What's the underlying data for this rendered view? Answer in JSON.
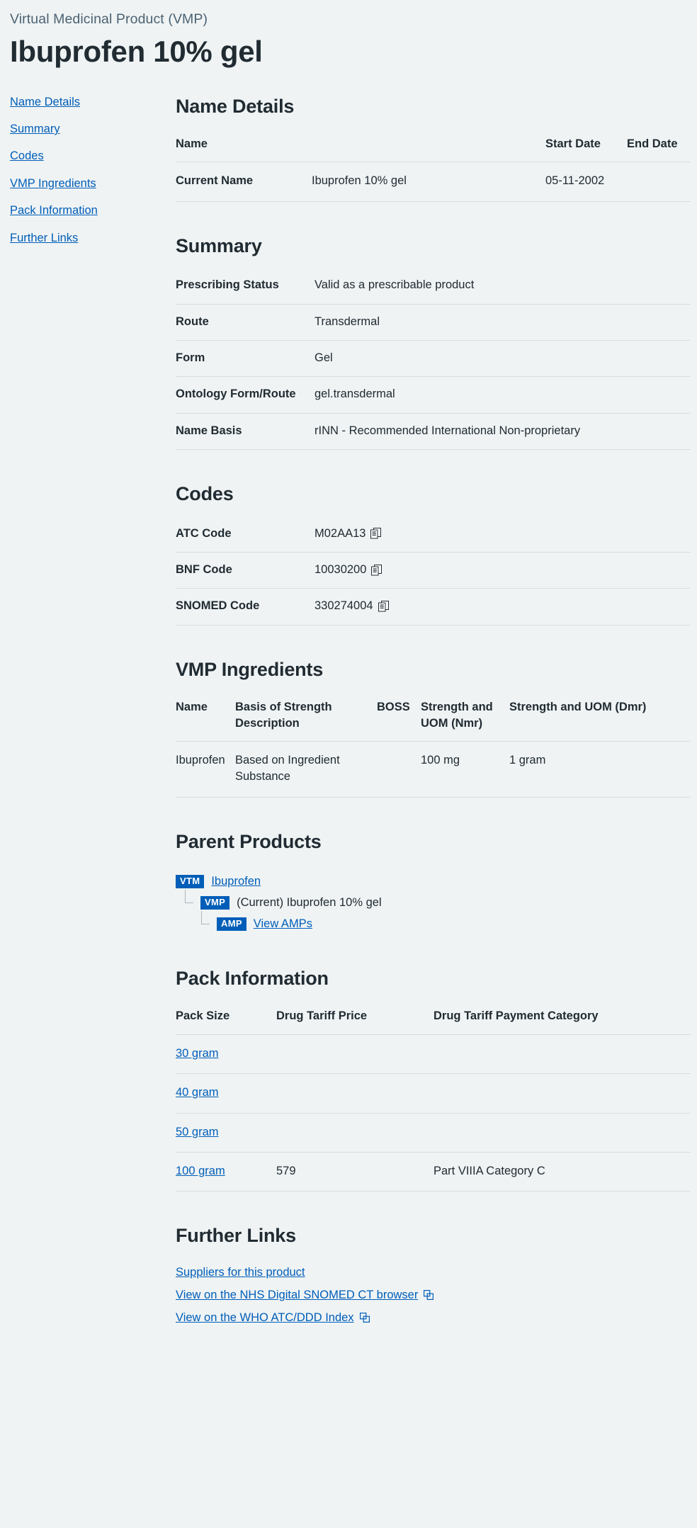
{
  "header": {
    "eyebrow": "Virtual Medicinal Product (VMP)",
    "title": "Ibuprofen 10% gel"
  },
  "sidebar": {
    "items": [
      {
        "label": "Name Details"
      },
      {
        "label": "Summary"
      },
      {
        "label": "Codes"
      },
      {
        "label": "VMP Ingredients"
      },
      {
        "label": "Pack Information"
      },
      {
        "label": "Further Links"
      }
    ]
  },
  "name_details": {
    "title": "Name Details",
    "columns": [
      "Name",
      "",
      "Start Date",
      "End Date"
    ],
    "rows": [
      {
        "label": "Current Name",
        "name": "Ibuprofen 10% gel",
        "start_date": "05-11-2002",
        "end_date": ""
      }
    ]
  },
  "summary": {
    "title": "Summary",
    "rows": [
      {
        "key": "Prescribing Status",
        "value": "Valid as a prescribable product"
      },
      {
        "key": "Route",
        "value": "Transdermal"
      },
      {
        "key": "Form",
        "value": "Gel"
      },
      {
        "key": "Ontology Form/Route",
        "value": "gel.transdermal"
      },
      {
        "key": "Name Basis",
        "value": "rINN - Recommended International Non-proprietary"
      }
    ]
  },
  "codes": {
    "title": "Codes",
    "rows": [
      {
        "key": "ATC Code",
        "value": "M02AA13",
        "copy_icon": "copy-icon"
      },
      {
        "key": "BNF Code",
        "value": "10030200",
        "copy_icon": "copy-icon"
      },
      {
        "key": "SNOMED Code",
        "value": "330274004",
        "copy_icon": "copy-icon"
      }
    ]
  },
  "vmp_ingredients": {
    "title": "VMP Ingredients",
    "columns": [
      "Name",
      "Basis of Strength Description",
      "BOSS",
      "Strength and UOM (Nmr)",
      "Strength and UOM (Dmr)"
    ],
    "rows": [
      {
        "name": "Ibuprofen",
        "basis": "Based on Ingredient Substance",
        "boss": "",
        "nmr": "100 mg",
        "dmr": "1 gram"
      }
    ]
  },
  "parent_products": {
    "title": "Parent Products",
    "nodes": [
      {
        "badge": "VTM",
        "label": "Ibuprofen",
        "is_link": true,
        "level": 1
      },
      {
        "badge": "VMP",
        "label": "(Current) Ibuprofen 10% gel",
        "is_link": false,
        "level": 2
      },
      {
        "badge": "AMP",
        "label": "View AMPs",
        "is_link": true,
        "level": 3
      }
    ]
  },
  "pack_information": {
    "title": "Pack Information",
    "columns": [
      "Pack Size",
      "Drug Tariff Price",
      "Drug Tariff Payment Category"
    ],
    "rows": [
      {
        "pack_size": "30 gram",
        "price": "",
        "category": ""
      },
      {
        "pack_size": "40 gram",
        "price": "",
        "category": ""
      },
      {
        "pack_size": "50 gram",
        "price": "",
        "category": ""
      },
      {
        "pack_size": "100 gram",
        "price": "579",
        "category": "Part VIIIA Category C"
      }
    ]
  },
  "further_links": {
    "title": "Further Links",
    "items": [
      {
        "label": "Suppliers for this product",
        "external": false
      },
      {
        "label": "View on the NHS Digital SNOMED CT browser",
        "external": true,
        "icon": "external-link-icon"
      },
      {
        "label": "View on the WHO ATC/DDD Index",
        "external": true,
        "icon": "external-link-icon"
      }
    ]
  },
  "colors": {
    "background": "#eff3f4",
    "text": "#212b32",
    "link": "#005eb8",
    "badge": "#005eb8",
    "muted": "#4c6272",
    "rule": "#d8dde0"
  }
}
